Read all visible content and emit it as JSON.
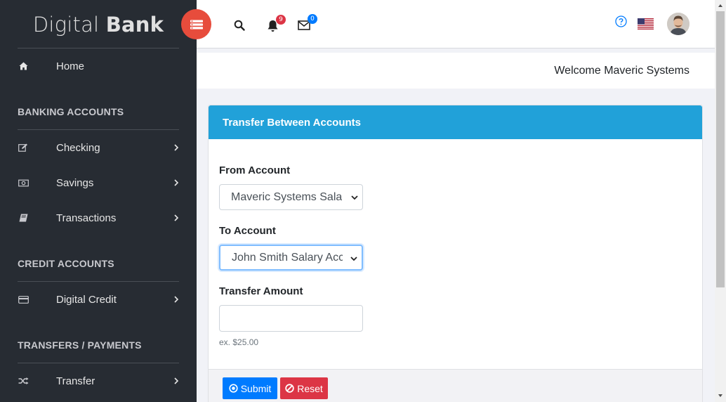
{
  "brand": {
    "light": "Digital ",
    "bold": "Bank"
  },
  "header": {
    "notifications_count": "9",
    "messages_count": "0",
    "notification_badge_color": "#dc3545",
    "message_badge_color": "#007bff",
    "help_icon_color": "#007bff",
    "toggle_color": "#e74c3c"
  },
  "welcome": {
    "text": "Welcome Maveric Systems"
  },
  "sidebar": {
    "home": {
      "label": "Home",
      "icon": "home-icon"
    },
    "sections": [
      {
        "title": "BANKING ACCOUNTS"
      },
      {
        "title": "CREDIT ACCOUNTS"
      },
      {
        "title": "TRANSFERS / PAYMENTS"
      }
    ],
    "items": [
      {
        "label": "Checking",
        "icon": "edit-icon"
      },
      {
        "label": "Savings",
        "icon": "money-icon"
      },
      {
        "label": "Transactions",
        "icon": "book-icon"
      },
      {
        "label": "Digital Credit",
        "icon": "credit-card-icon"
      },
      {
        "label": "Transfer",
        "icon": "random-icon"
      }
    ]
  },
  "form": {
    "title": "Transfer Between Accounts",
    "from_label": "From Account",
    "from_value": "Maveric Systems Salary Account",
    "to_label": "To Account",
    "to_value": "John Smith Salary Account",
    "amount_label": "Transfer Amount",
    "amount_value": "",
    "amount_help": "ex. $25.00",
    "submit_label": "Submit",
    "reset_label": "Reset",
    "header_color": "#21a1d9"
  }
}
